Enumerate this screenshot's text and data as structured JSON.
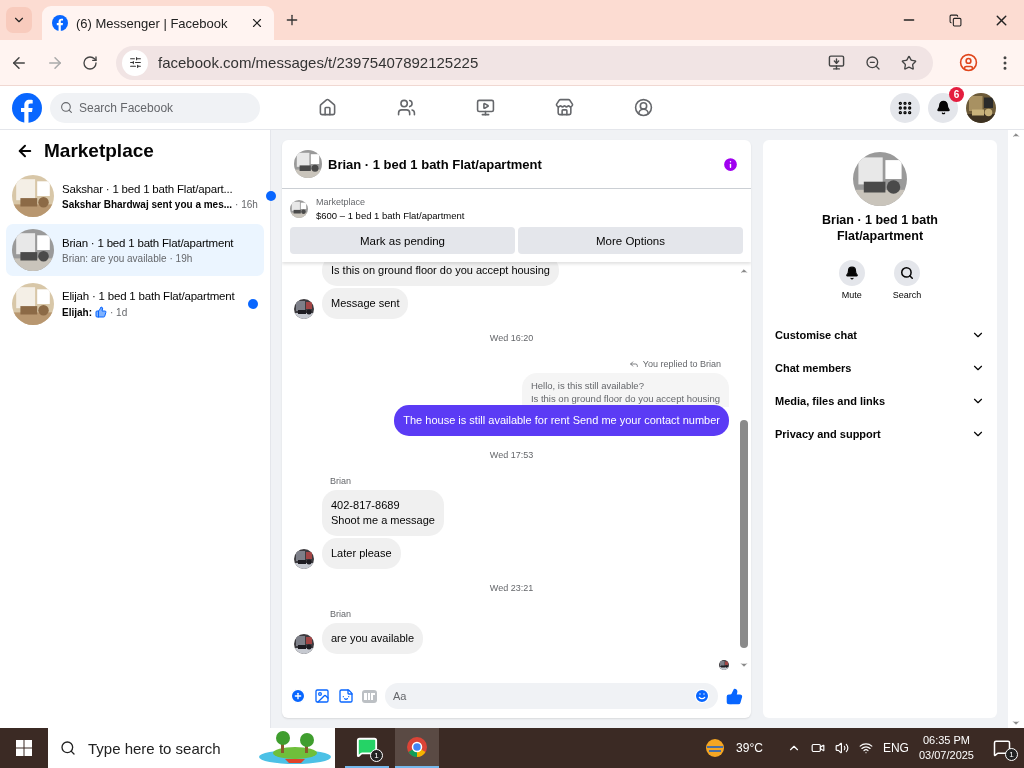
{
  "browser": {
    "tab_title": "(6) Messenger | Facebook",
    "url": "facebook.com/messages/t/23975407892125225"
  },
  "fb_header": {
    "search_placeholder": "Search Facebook",
    "notification_count": "6"
  },
  "sidebar": {
    "title": "Marketplace",
    "chats": [
      {
        "title": "Sakshar · 1 bed 1 bath Flat/apart...",
        "preview": "Sakshar Bhardwaj sent you a mes...",
        "like": false,
        "time": "· 16h",
        "unread": true,
        "selected": false
      },
      {
        "title": "Brian · 1 bed 1 bath Flat/apartment",
        "preview": "Brian: are you available",
        "like": false,
        "time": "· 19h",
        "unread": false,
        "selected": true
      },
      {
        "title": "Elijah · 1 bed 1 bath Flat/apartment",
        "preview": "Elijah:",
        "like": true,
        "time": "· 1d",
        "unread": true,
        "selected": false
      }
    ]
  },
  "chat": {
    "title": "Brian · 1 bed 1 bath Flat/apartment",
    "listing": {
      "label": "Marketplace",
      "summary": "$600 – 1 bed 1 bath Flat/apartment"
    },
    "actions": [
      "Mark as pending",
      "More Options"
    ],
    "messages": [
      {
        "kind": "incoming",
        "text": "Is this on ground floor do you accept housing",
        "avatar": false
      },
      {
        "kind": "incoming",
        "text": "Message sent",
        "avatar": true
      },
      {
        "kind": "time",
        "text": "Wed 16:20"
      },
      {
        "kind": "reply_note",
        "text": "You replied to Brian"
      },
      {
        "kind": "quote",
        "text": "Hello, is this still available?\nIs this on ground floor do you accept housing"
      },
      {
        "kind": "outgoing",
        "text": "The house is still available for rent Send me your contact number"
      },
      {
        "kind": "time",
        "text": "Wed 17:53"
      },
      {
        "kind": "sender",
        "text": "Brian"
      },
      {
        "kind": "incoming",
        "text": "402-817-8689\nShoot me a message",
        "avatar": false
      },
      {
        "kind": "incoming",
        "text": "Later please",
        "avatar": true
      },
      {
        "kind": "time",
        "text": "Wed 23:21"
      },
      {
        "kind": "sender",
        "text": "Brian"
      },
      {
        "kind": "incoming",
        "text": "are you available",
        "avatar": true
      }
    ],
    "composer": {
      "placeholder": "Aa"
    }
  },
  "details": {
    "title": "Brian · 1 bed 1 bath Flat/apartment",
    "actions": [
      {
        "kind": "mute",
        "label": "Mute"
      },
      {
        "kind": "search",
        "label": "Search"
      }
    ],
    "sections": [
      {
        "label": "Customise chat",
        "expanded": false
      },
      {
        "label": "Chat members",
        "expanded": false
      },
      {
        "label": "Media, files and links",
        "expanded": false
      },
      {
        "label": "Privacy and support",
        "expanded": false
      }
    ]
  },
  "taskbar": {
    "search_placeholder": "Type here to search",
    "whatsapp_badge": "1",
    "weather": "39°C",
    "language": "ENG",
    "time": "06:35 PM",
    "date": "03/07/2025",
    "notification_badge": "1"
  }
}
